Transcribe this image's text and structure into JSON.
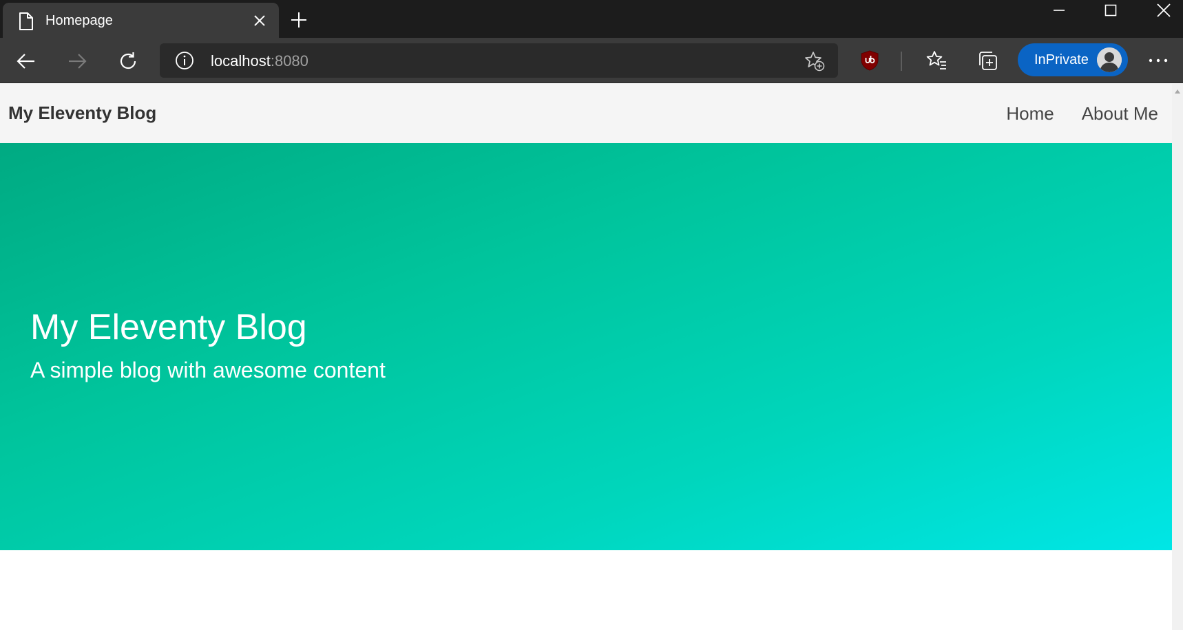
{
  "browser": {
    "tab": {
      "title": "Homepage"
    },
    "address": {
      "host": "localhost",
      "port": ":8080"
    },
    "inprivate_label": "InPrivate",
    "icons": {
      "page": "page-icon",
      "close_tab": "close-icon",
      "new_tab": "plus-icon",
      "back": "arrow-left-icon",
      "forward": "arrow-right-icon",
      "refresh": "refresh-icon",
      "info": "info-icon",
      "add_favorite": "star-plus-icon",
      "ublock": "ublock-shield-icon",
      "favorites": "favorites-icon",
      "collections": "collections-icon",
      "more": "more-icon",
      "minimize": "minimize-icon",
      "maximize": "maximize-icon",
      "close_window": "close-icon"
    },
    "colors": {
      "titlebar": "#1c1c1c",
      "toolbar": "#3b3b3b",
      "inprivate": "#0a64c4"
    }
  },
  "site": {
    "brand": "My Eleventy Blog",
    "nav": [
      {
        "label": "Home"
      },
      {
        "label": "About Me"
      }
    ],
    "hero": {
      "title": "My Eleventy Blog",
      "subtitle": "A simple blog with awesome content",
      "gradient_start": "#00aa82",
      "gradient_end": "#00e6e6"
    }
  }
}
